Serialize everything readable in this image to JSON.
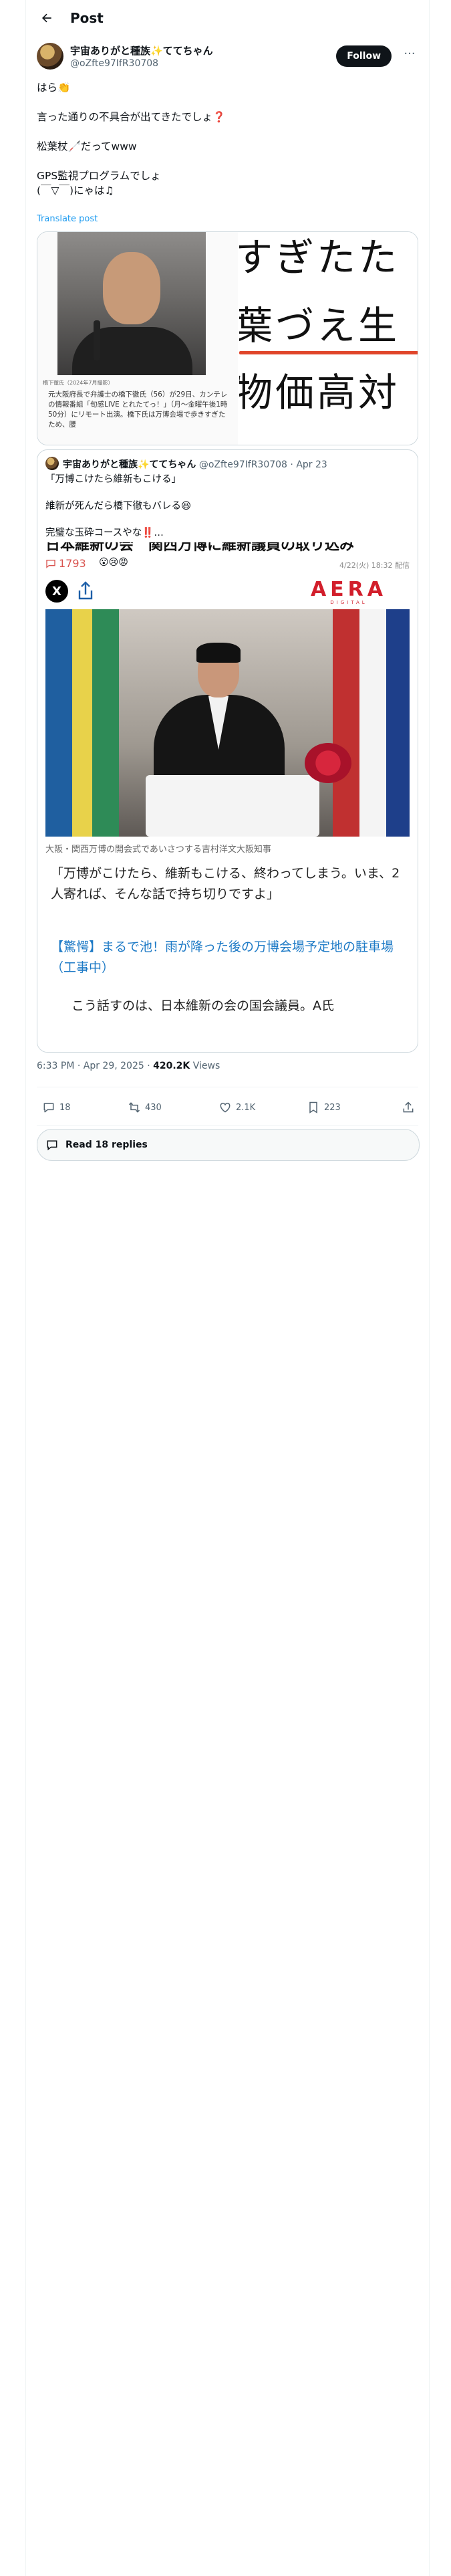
{
  "header": {
    "title": "Post"
  },
  "author": {
    "display_name": "宇宙ありがと種族✨ててちゃん",
    "handle": "@oZfte97IfR30708",
    "follow_label": "Follow"
  },
  "post": {
    "lines": [
      "はら👏",
      "言った通りの不具合が出てきたでしょ❓",
      "松葉杖🦯だってwww",
      "GPS監視プログラムでしょ",
      "(￣▽￣)にゃは♫"
    ],
    "translate_label": "Translate post"
  },
  "card1": {
    "photo_caption": "橋下徹氏（2024年7月撮影）",
    "text": "元大阪府長で弁護士の橋下徹氏（56）が29日、カンテレの情報番組「旬感LIVE とれたてっ！」（月〜金曜午後1時50分）にリモート出演。橋下氏は万博会場で歩きすぎたため、腰",
    "big_lines": [
      "すぎたた",
      "葉づえ生",
      "物価高対"
    ]
  },
  "quote": {
    "display_name": "宇宙ありがと種族✨ててちゃん",
    "handle_date": "@oZfte97IfR30708 · Apr 23",
    "lines": [
      "「万博こけたら維新もこける」",
      "維新が死んだら橋下徹もバレる😆",
      "完璧な玉砕コースやな‼️…"
    ],
    "article": {
      "cut_headline": "日本維新の会　関西万博に維新議員の取り込み",
      "comment_count": "1793",
      "reactions": "😮😢😡",
      "published": "4/22(火) 18:32 配信",
      "x_label": "X",
      "logo": "AERA",
      "logo_sub": "DIGITAL",
      "photo_caption": "大阪・関西万博の開会式であいさつする吉村洋文大阪知事",
      "quote_text": "「万博がこけたら、維新もこける、終わってしまう。いま、2人寄れば、そんな話で持ち切りですよ」",
      "link_text": "【驚愕】まるで池！雨が降った後の万博会場予定地の駐車場（工事中）",
      "tail_text": "　こう話すのは、日本維新の会の国会議員。A氏"
    }
  },
  "meta": {
    "time": "6:33 PM · Apr 29, 2025 · ",
    "views": "420.2K",
    "views_label": " Views"
  },
  "actions": {
    "replies": "18",
    "reposts": "430",
    "likes": "2.1K",
    "bookmarks": "223"
  },
  "read_replies": "Read 18 replies"
}
